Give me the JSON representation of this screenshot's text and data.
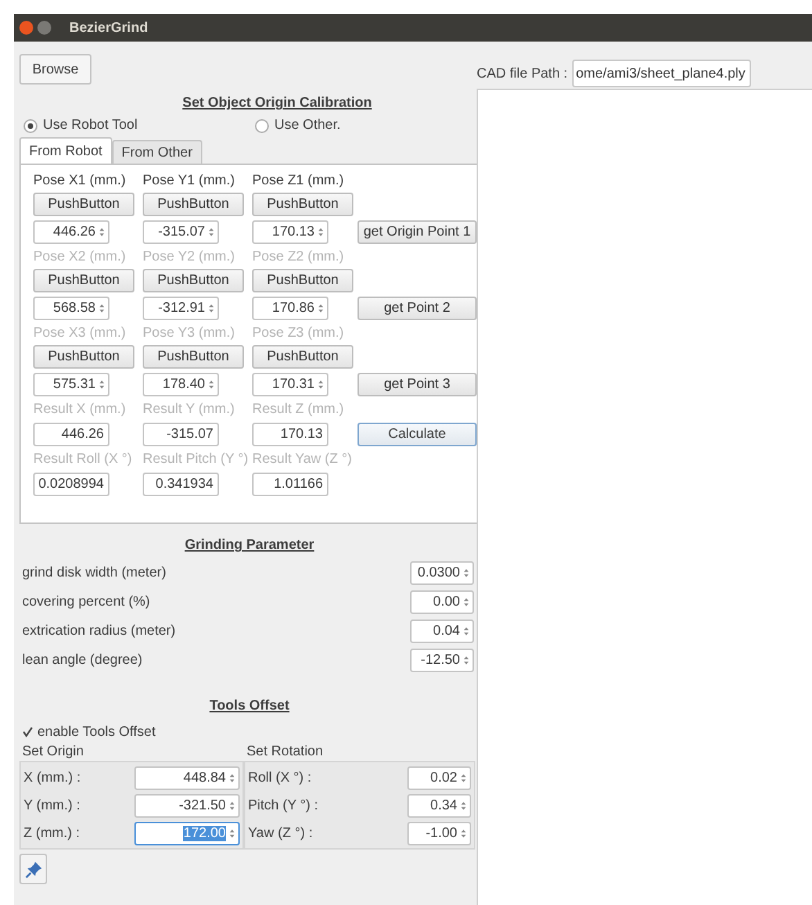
{
  "window": {
    "title": "BezierGrind"
  },
  "browse_button": "Browse",
  "cad_path": {
    "label": "CAD file Path :",
    "value": "ome/ami3/sheet_plane4.ply"
  },
  "calibration": {
    "title": "Set Object Origin Calibration",
    "radios": [
      {
        "label": "Use Robot Tool",
        "selected": true
      },
      {
        "label": "Use Other.",
        "selected": false
      }
    ],
    "tabs": [
      {
        "label": "From Robot",
        "selected": true
      },
      {
        "label": "From Other",
        "selected": false
      }
    ],
    "pose_groups": [
      {
        "labels": [
          "Pose X1 (mm.)",
          "Pose Y1 (mm.)",
          "Pose Z1 (mm.)"
        ],
        "disabled": false,
        "buttons": [
          "PushButton",
          "PushButton",
          "PushButton"
        ],
        "values": [
          "446.26",
          "-315.07",
          "170.13"
        ],
        "action": "get Origin Point 1"
      },
      {
        "labels": [
          "Pose X2 (mm.)",
          "Pose Y2 (mm.)",
          "Pose Z2 (mm.)"
        ],
        "disabled": true,
        "buttons": [
          "PushButton",
          "PushButton",
          "PushButton"
        ],
        "values": [
          "568.58",
          "-312.91",
          "170.86"
        ],
        "action": "get Point 2"
      },
      {
        "labels": [
          "Pose X3 (mm.)",
          "Pose Y3 (mm.)",
          "Pose Z3 (mm.)"
        ],
        "disabled": true,
        "buttons": [
          "PushButton",
          "PushButton",
          "PushButton"
        ],
        "values": [
          "575.31",
          "178.40",
          "170.31"
        ],
        "action": "get Point 3"
      }
    ],
    "result_groups": [
      {
        "labels": [
          "Result X (mm.)",
          "Result Y (mm.)",
          "Result Z (mm.)"
        ],
        "disabled": true,
        "values": [
          "446.26",
          "-315.07",
          "170.13"
        ],
        "action": "Calculate"
      },
      {
        "labels": [
          "Result Roll  (X °)",
          "Result Pitch (Y °)",
          "Result Yaw (Z °)"
        ],
        "disabled": true,
        "values": [
          "0.0208994",
          "0.341934",
          "1.01166"
        ]
      }
    ]
  },
  "grinding": {
    "title": "Grinding Parameter",
    "rows": [
      {
        "label": "grind disk width (meter)",
        "value": "0.0300"
      },
      {
        "label": "covering percent (%)",
        "value": "0.00"
      },
      {
        "label": "extrication radius (meter)",
        "value": "0.04"
      },
      {
        "label": "lean angle (degree)",
        "value": "-12.50"
      }
    ]
  },
  "tools_offset": {
    "title": "Tools Offset",
    "checkbox": {
      "label": "enable Tools Offset",
      "checked": true
    },
    "origin": {
      "title": "Set Origin",
      "rows": [
        {
          "label": "X  (mm.) :",
          "value": "448.84",
          "selected": false
        },
        {
          "label": "Y  (mm.) :",
          "value": "-321.50",
          "selected": false
        },
        {
          "label": "Z  (mm.) :",
          "value": "172.00",
          "selected": true
        }
      ]
    },
    "rotation": {
      "title": "Set Rotation",
      "rows": [
        {
          "label": "Roll  (X °) :",
          "value": "0.02",
          "selected": false
        },
        {
          "label": "Pitch (Y °) :",
          "value": "0.34",
          "selected": false
        },
        {
          "label": "Yaw  (Z °) :",
          "value": "-1.00",
          "selected": false
        }
      ]
    }
  }
}
